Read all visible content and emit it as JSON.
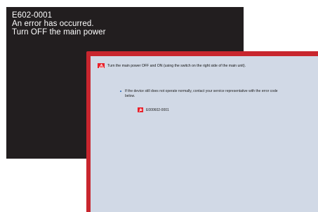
{
  "error_screen": {
    "lines": [
      "E602-0001",
      "An error has occurred.",
      "Turn OFF the main power"
    ]
  },
  "panel": {
    "warning_icon": "warning-icon",
    "message": "Turn the main power OFF and ON (using the switch on the right side of the main unit).",
    "bullet": "If the device still does not operate normally, contact your service representative with the error code below.",
    "code_icon": "wrench-icon",
    "error_code": "E000602-0001"
  },
  "colors": {
    "black_screen": "#221e1f",
    "frame_red": "#c8262e",
    "panel_bg": "#d1d9e6",
    "icon_red": "#e8202a",
    "bullet_blue": "#4a7fc1"
  }
}
